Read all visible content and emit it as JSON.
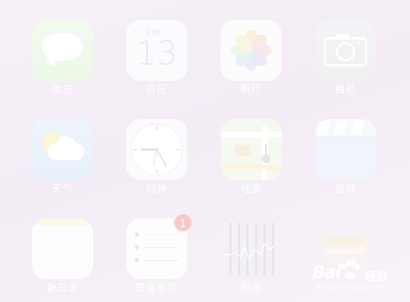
{
  "home": {
    "apps": [
      {
        "id": "messages",
        "label": "信息"
      },
      {
        "id": "calendar",
        "label": "日历",
        "day_text": "星期二",
        "date_text": "13"
      },
      {
        "id": "photos",
        "label": "照片"
      },
      {
        "id": "camera",
        "label": "相机"
      },
      {
        "id": "weather",
        "label": "天气"
      },
      {
        "id": "clock",
        "label": "时钟"
      },
      {
        "id": "maps",
        "label": "地图"
      },
      {
        "id": "videos",
        "label": "视频"
      },
      {
        "id": "notes",
        "label": "备忘录"
      },
      {
        "id": "reminders",
        "label": "提醒事项",
        "badge": "1"
      },
      {
        "id": "stocks",
        "label": "股市"
      },
      {
        "id": "passbook",
        "label": ""
      }
    ]
  },
  "watermark": {
    "brand": "Bai",
    "brand_suffix": "经验",
    "url": "jingyan.baidu.com"
  },
  "colors": {
    "background": "#f5eef6",
    "label": "#ffffff",
    "badge": "#f7c9cb"
  },
  "icons": {
    "messages": "speech-bubble-icon",
    "calendar": "calendar-icon",
    "photos": "pinwheel-icon",
    "camera": "camera-icon",
    "weather": "sun-cloud-icon",
    "clock": "clock-icon",
    "maps": "map-icon",
    "videos": "clapperboard-icon",
    "notes": "notepad-icon",
    "reminders": "checklist-icon",
    "stocks": "stock-chart-icon",
    "passbook": "wallet-icon"
  }
}
